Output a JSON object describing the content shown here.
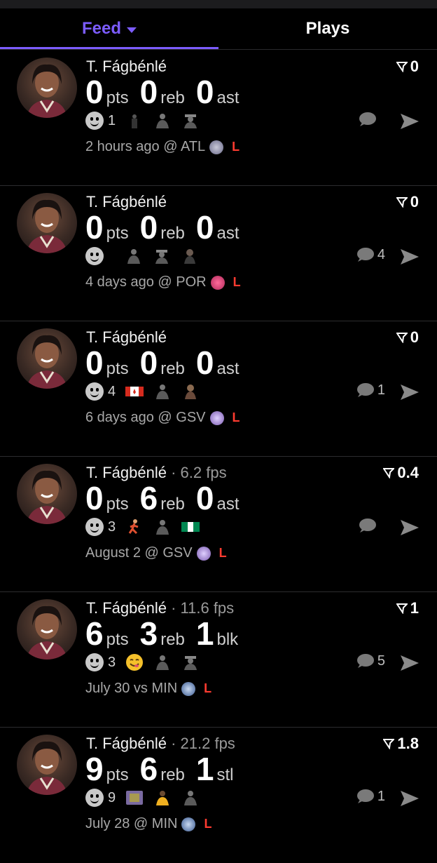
{
  "tabs": [
    {
      "label": "Feed",
      "active": true
    },
    {
      "label": "Plays",
      "active": false
    }
  ],
  "colors": {
    "accent": "#7c5cff",
    "loss": "#ff3b30",
    "background": "#000000"
  },
  "feed": [
    {
      "name": "T. Fágbénlé",
      "fps_text": "",
      "score": "0",
      "stats": [
        {
          "value": "0",
          "label": "pts"
        },
        {
          "value": "0",
          "label": "reb"
        },
        {
          "value": "0",
          "label": "ast"
        }
      ],
      "reaction_count": "1",
      "reactions": [
        "person-icon",
        "coach-icon",
        "cowboy-icon"
      ],
      "comment_count": "",
      "time": "2 hours ago @ ATL",
      "team_icon": "hawks-logo",
      "result": "L"
    },
    {
      "name": "T. Fágbénlé",
      "fps_text": "",
      "score": "0",
      "stats": [
        {
          "value": "0",
          "label": "pts"
        },
        {
          "value": "0",
          "label": "reb"
        },
        {
          "value": "0",
          "label": "ast"
        }
      ],
      "reaction_count": "",
      "reactions": [
        "coach-icon",
        "cowboy-icon",
        "player-icon"
      ],
      "comment_count": "4",
      "time": "4 days ago @ POR",
      "team_icon": "fire-logo",
      "result": "L"
    },
    {
      "name": "T. Fágbénlé",
      "fps_text": "",
      "score": "0",
      "stats": [
        {
          "value": "0",
          "label": "pts"
        },
        {
          "value": "0",
          "label": "reb"
        },
        {
          "value": "0",
          "label": "ast"
        }
      ],
      "reaction_count": "4",
      "reactions": [
        "canada-flag-icon",
        "coach-icon",
        "player-icon"
      ],
      "comment_count": "1",
      "time": "6 days ago @ GSV",
      "team_icon": "valkyries-logo",
      "result": "L"
    },
    {
      "name": "T. Fágbénlé",
      "fps_text": " · 6.2 fps",
      "score": "0.4",
      "stats": [
        {
          "value": "0",
          "label": "pts"
        },
        {
          "value": "6",
          "label": "reb"
        },
        {
          "value": "0",
          "label": "ast"
        }
      ],
      "reaction_count": "3",
      "reactions": [
        "runner-icon",
        "coach-icon",
        "nigeria-flag-icon"
      ],
      "comment_count": "",
      "time": "August 2 @ GSV",
      "team_icon": "valkyries-logo",
      "result": "L"
    },
    {
      "name": "T. Fágbénlé",
      "fps_text": " · 11.6 fps",
      "score": "1",
      "stats": [
        {
          "value": "6",
          "label": "pts"
        },
        {
          "value": "3",
          "label": "reb"
        },
        {
          "value": "1",
          "label": "blk"
        }
      ],
      "reaction_count": "3",
      "reactions": [
        "yum-emoji-icon",
        "coach-icon",
        "cowboy-icon"
      ],
      "comment_count": "5",
      "time": "July 30 vs MIN",
      "team_icon": "lynx-logo",
      "result": "L"
    },
    {
      "name": "T. Fágbénlé",
      "fps_text": " · 21.2 fps",
      "score": "1.8",
      "stats": [
        {
          "value": "9",
          "label": "pts"
        },
        {
          "value": "6",
          "label": "reb"
        },
        {
          "value": "1",
          "label": "stl"
        }
      ],
      "reaction_count": "9",
      "reactions": [
        "badge-icon",
        "lakers-player-icon",
        "coach-icon"
      ],
      "comment_count": "1",
      "time": "July 28 @ MIN",
      "team_icon": "lynx-logo",
      "result": "L"
    }
  ]
}
